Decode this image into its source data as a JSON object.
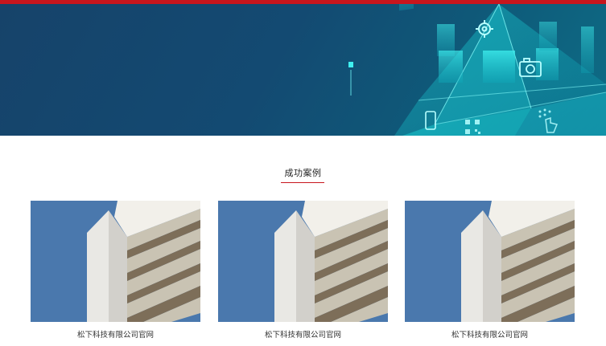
{
  "section": {
    "title": "成功案例"
  },
  "cases": [
    {
      "name": "松下科技有限公司官网"
    },
    {
      "name": "松下科技有限公司官网"
    },
    {
      "name": "松下科技有限公司官网"
    }
  ],
  "colors": {
    "accent": "#c8161d",
    "hero_dark": "#16436a",
    "hero_cyan": "#2fe0e6"
  },
  "icons": [
    "gear-icon",
    "camera-icon",
    "smartphone-icon",
    "qr-code-icon",
    "touch-icon"
  ]
}
